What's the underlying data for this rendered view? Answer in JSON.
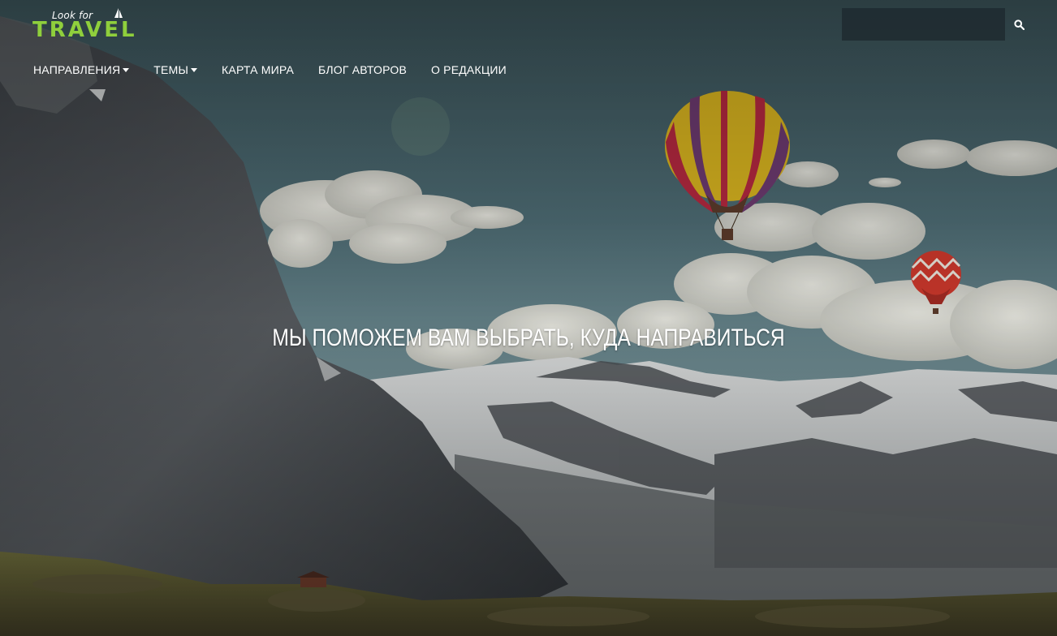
{
  "logo": {
    "small_text": "Look for",
    "big_text": "TRAVEL",
    "accent_color": "#8fcf3c"
  },
  "search": {
    "placeholder": "",
    "value": "",
    "icon": "search-icon"
  },
  "nav": {
    "items": [
      {
        "label": "НАПРАВЛЕНИЯ",
        "has_dropdown": true
      },
      {
        "label": "ТЕМЫ",
        "has_dropdown": true
      },
      {
        "label": "КАРТА МИРА",
        "has_dropdown": false
      },
      {
        "label": "БЛОГ АВТОРОВ",
        "has_dropdown": false
      },
      {
        "label": "О РЕДАКЦИИ",
        "has_dropdown": false
      }
    ]
  },
  "hero": {
    "headline": "МЫ ПОМОЖЕМ ВАМ ВЫБРАТЬ, КУДА НАПРАВИТЬСЯ",
    "image_subject": "mountains-with-hot-air-balloons"
  }
}
